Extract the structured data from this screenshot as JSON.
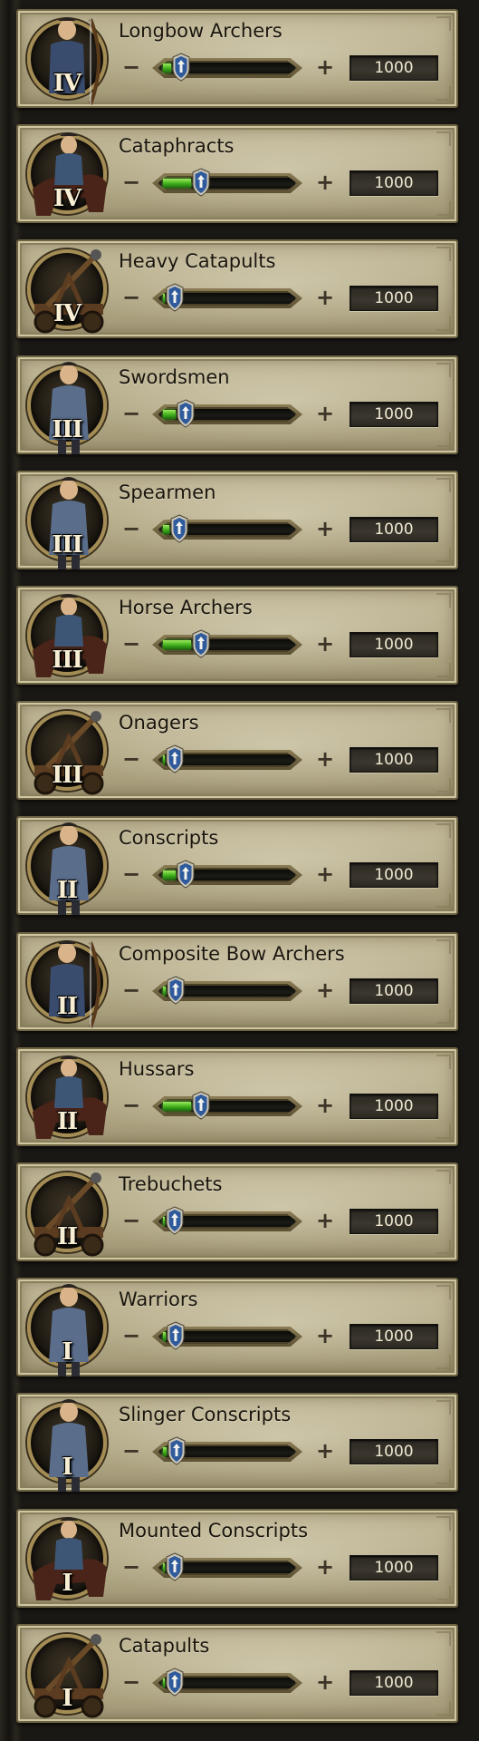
{
  "units": [
    {
      "name": "Longbow Archers",
      "tier": "IV",
      "value": "1000",
      "fill_fraction": 0.06,
      "kind": "archer"
    },
    {
      "name": "Cataphracts",
      "tier": "IV",
      "value": "1000",
      "fill_fraction": 0.22,
      "kind": "cavalry"
    },
    {
      "name": "Heavy Catapults",
      "tier": "IV",
      "value": "1000",
      "fill_fraction": 0.0,
      "kind": "siege"
    },
    {
      "name": "Swordsmen",
      "tier": "III",
      "value": "1000",
      "fill_fraction": 0.1,
      "kind": "infantry"
    },
    {
      "name": "Spearmen",
      "tier": "III",
      "value": "1000",
      "fill_fraction": 0.05,
      "kind": "infantry"
    },
    {
      "name": "Horse Archers",
      "tier": "III",
      "value": "1000",
      "fill_fraction": 0.22,
      "kind": "cavalry"
    },
    {
      "name": "Onagers",
      "tier": "III",
      "value": "1000",
      "fill_fraction": 0.0,
      "kind": "siege"
    },
    {
      "name": "Conscripts",
      "tier": "II",
      "value": "1000",
      "fill_fraction": 0.1,
      "kind": "infantry"
    },
    {
      "name": "Composite Bow Archers",
      "tier": "II",
      "value": "1000",
      "fill_fraction": 0.02,
      "kind": "archer"
    },
    {
      "name": "Hussars",
      "tier": "II",
      "value": "1000",
      "fill_fraction": 0.22,
      "kind": "cavalry"
    },
    {
      "name": "Trebuchets",
      "tier": "II",
      "value": "1000",
      "fill_fraction": 0.0,
      "kind": "siege"
    },
    {
      "name": "Warriors",
      "tier": "I",
      "value": "1000",
      "fill_fraction": 0.02,
      "kind": "infantry"
    },
    {
      "name": "Slinger Conscripts",
      "tier": "I",
      "value": "1000",
      "fill_fraction": 0.03,
      "kind": "infantry"
    },
    {
      "name": "Mounted Conscripts",
      "tier": "I",
      "value": "1000",
      "fill_fraction": 0.0,
      "kind": "cavalry"
    },
    {
      "name": "Catapults",
      "tier": "I",
      "value": "1000",
      "fill_fraction": 0.0,
      "kind": "siege"
    }
  ],
  "controls": {
    "minus": "−",
    "plus": "+"
  },
  "colors": {
    "fill": "#3fae1c",
    "handle": "#2f5a9c",
    "panel": "#b8ae8c"
  },
  "icons": {
    "handle": "arrow-up-shield-icon"
  }
}
